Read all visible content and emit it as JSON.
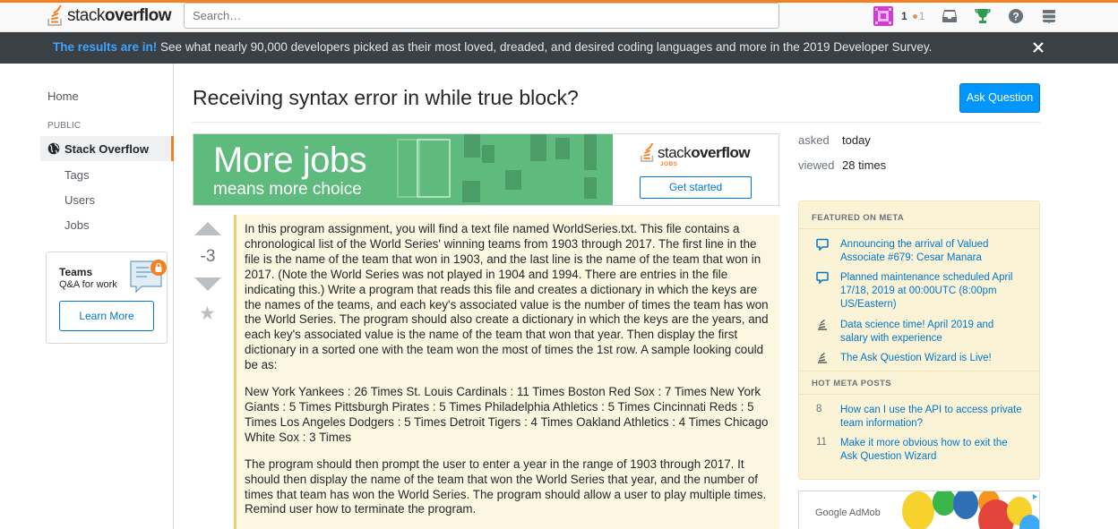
{
  "header": {
    "logo_text_light": "stack",
    "logo_text_bold": "overflow",
    "search_placeholder": "Search…",
    "reputation": "1",
    "bronze_badges": "1",
    "icons": [
      "inbox-icon",
      "achievements-icon",
      "help-icon",
      "site-switcher-icon"
    ]
  },
  "banner": {
    "highlight": "The results are in!",
    "text": " See what nearly 90,000 developers picked as their most loved, dreaded, and desired coding languages and more in the 2019 Developer Survey."
  },
  "nav": {
    "home": "Home",
    "public_label": "PUBLIC",
    "stack_overflow": "Stack Overflow",
    "tags": "Tags",
    "users": "Users",
    "jobs": "Jobs",
    "teams_title": "Teams",
    "teams_sub": "Q&A for work",
    "teams_button": "Learn More"
  },
  "question": {
    "title": "Receiving syntax error in while true block?",
    "ask_button": "Ask Question",
    "score": "-3",
    "body": [
      "In this program assignment, you will find a text file named WorldSeries.txt. This file contains a chronological list of the World Series' winning teams from 1903 through 2017. The first line in the file is the name of the team that won in 1903, and the last line is the name of the team that won in 2017. (Note the World Series was not played in 1904 and 1994. There are entries in the file indicating this.) Write a program that reads this file and creates a dictionary in which the keys are the names of the teams, and each key's associated value is the number of times the team has won the World Series. The program should also create a dictionary in which the keys are the years, and each key's associated value is the name of the team that won that year. Then display the first dictionary in a sorted one with the team won the most of times the 1st row. A sample looking could be as:",
      "New York Yankees : 26 Times St. Louis Cardinals : 11 Times Boston Red Sox : 7 Times New York Giants : 5 Times Pittsburgh Pirates : 5 Times Philadelphia Athletics : 5 Times Cincinnati Reds : 5 Times Los Angeles Dodgers : 5 Times Detroit Tigers : 4 Times Oakland Athletics : 4 Times Chicago White Sox : 3 Times",
      "The program should then prompt the user to enter a year in the range of 1903 through 2017. It should then display the name of the team that won the World Series that year, and the number of times that team has won the World Series. The program should allow a user to play multiple times. Remind user how to terminate the program."
    ]
  },
  "ad": {
    "headline": "More jobs",
    "subline": "means more choice",
    "logo_light": "stack",
    "logo_bold": "overflow",
    "logo_sub": "JOBS",
    "button": "Get started"
  },
  "stats": {
    "asked_label": "asked",
    "asked_value": "today",
    "viewed_label": "viewed",
    "viewed_value": "28 times"
  },
  "meta": {
    "featured_heading": "FEATURED ON META",
    "featured": [
      {
        "icon": "speech-bubble-icon",
        "text": "Announcing the arrival of Valued Associate #679: Cesar Manara"
      },
      {
        "icon": "speech-bubble-icon",
        "text": "Planned maintenance scheduled April 17/18, 2019 at 00:00UTC (8:00pm US/Eastern)"
      },
      {
        "icon": "stack-exchange-icon",
        "text": "Data science time! April 2019 and salary with experience"
      },
      {
        "icon": "stack-exchange-icon",
        "text": "The Ask Question Wizard is Live!"
      }
    ],
    "hot_heading": "HOT META POSTS",
    "hot": [
      {
        "score": "8",
        "text": "How can I use the API to access private team information?"
      },
      {
        "score": "11",
        "text": "Make it more obvious how to exit the Ask Question Wizard"
      }
    ]
  },
  "admob": {
    "text": "Google AdMob"
  }
}
